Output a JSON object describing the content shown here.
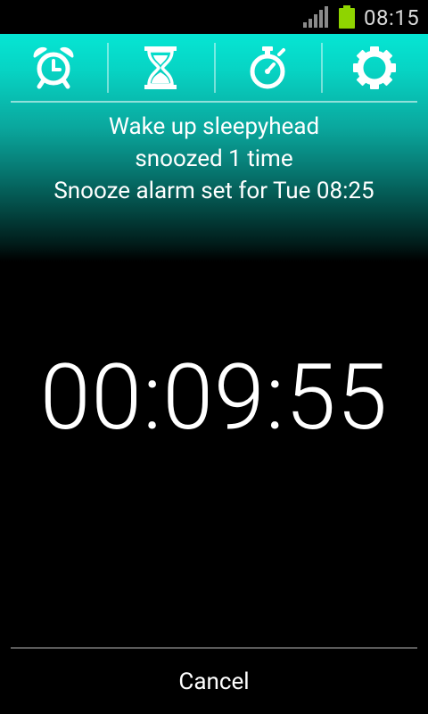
{
  "status_bar": {
    "time": "08:15",
    "signal_icon": "signal-bars-icon",
    "battery_icon": "battery-icon",
    "battery_color": "#8fd400"
  },
  "tabs": [
    {
      "name": "alarm",
      "icon": "alarm-clock-icon"
    },
    {
      "name": "timer",
      "icon": "hourglass-icon"
    },
    {
      "name": "stopwatch",
      "icon": "stopwatch-icon"
    },
    {
      "name": "settings",
      "icon": "gear-icon"
    }
  ],
  "alarm_info": {
    "title": "Wake up sleepyhead",
    "snooze_count": "snoozed 1 time",
    "snooze_message": "Snooze alarm set for Tue 08:25"
  },
  "countdown": "00:09:55",
  "cancel_label": "Cancel",
  "colors": {
    "accent": "#05e6d4",
    "background": "#000000",
    "text": "#ffffff"
  }
}
